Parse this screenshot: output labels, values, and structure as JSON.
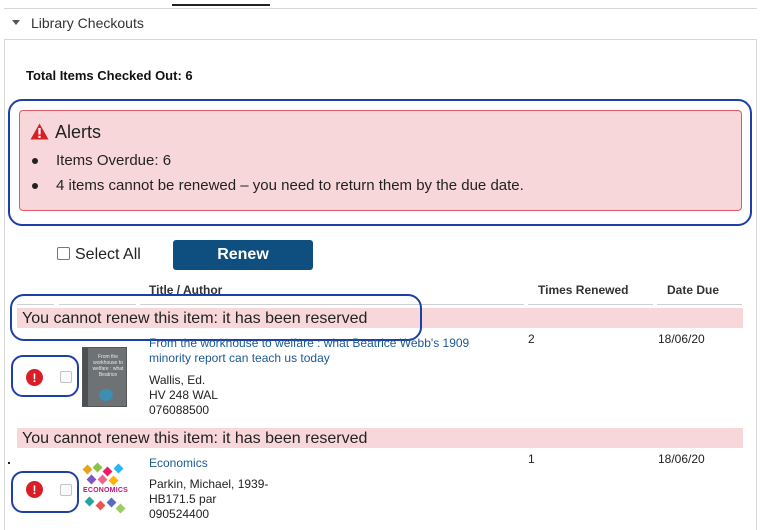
{
  "panel": {
    "title": "Library Checkouts",
    "total_items": "Total Items Checked Out: 6"
  },
  "alerts": {
    "title": "Alerts",
    "items": [
      "Items Overdue: 6",
      "4 items cannot be renewed – you need to return them by the due date."
    ],
    "colors": {
      "background": "#f8d7da",
      "border": "#e05a66",
      "icon": "#d61f26"
    },
    "icon": "warning-triangle-icon"
  },
  "controls": {
    "select_all_label": "Select All",
    "renew_label": "Renew",
    "renew_color": "#0f4f7f"
  },
  "table": {
    "headers": {
      "title_author": "Title / Author",
      "times_renewed": "Times Renewed",
      "date_due": "Date Due"
    },
    "rows": [
      {
        "message": "You cannot renew this item: it has been reserved",
        "title": "From the workhouse to welfare : what Beatrice Webb's 1909 minority report can teach us today",
        "author": "Wallis, Ed.",
        "call_number": "HV 248 WAL",
        "barcode": "076088500",
        "times_renewed": "2",
        "date_due": "18/06/20",
        "cover_text": "From the workhouse to welfare : what Beatrice"
      },
      {
        "message": "You cannot renew this item: it has been reserved",
        "title": "Economics",
        "author": "Parkin, Michael, 1939-",
        "call_number": "HB171.5 par",
        "barcode": "090524400",
        "times_renewed": "1",
        "date_due": "18/06/20",
        "cover_text": "ECONOMICS"
      }
    ]
  },
  "annotation_color": "#1f3fa8"
}
